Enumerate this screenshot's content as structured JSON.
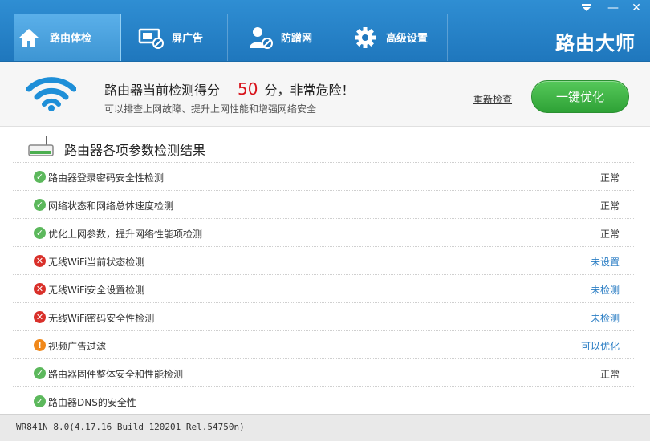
{
  "window": {
    "menu_icon": "dropdown-menu-icon",
    "min_label": "—",
    "close_label": "✕"
  },
  "tabs": [
    {
      "label": "路由体检",
      "icon": "home-icon",
      "active": true
    },
    {
      "label": "屏广告",
      "icon": "block-ad-icon",
      "active": false
    },
    {
      "label": "防蹭网",
      "icon": "user-block-icon",
      "active": false
    },
    {
      "label": "高级设置",
      "icon": "gear-icon",
      "active": false
    }
  ],
  "brand": "路由大师",
  "score_panel": {
    "title_prefix": "路由器当前检测得分",
    "score": "50",
    "title_suffix": "分，非常危险！",
    "subtitle": "可以排查上网故障、提升上网性能和增强网络安全",
    "recheck_label": "重新检查",
    "optimize_label": "一键优化"
  },
  "section": {
    "title": "路由器各项参数检测结果"
  },
  "checks": [
    {
      "label": "路由器登录密码安全性检测",
      "status": "ok",
      "result": "正常"
    },
    {
      "label": "网络状态和网络总体速度检测",
      "status": "ok",
      "result": "正常"
    },
    {
      "label": "优化上网参数，提升网络性能项检测",
      "status": "ok",
      "result": "正常"
    },
    {
      "label": "无线WiFi当前状态检测",
      "status": "error",
      "result": "未设置"
    },
    {
      "label": "无线WiFi安全设置检测",
      "status": "error",
      "result": "未检测"
    },
    {
      "label": "无线WiFi密码安全性检测",
      "status": "error",
      "result": "未检测"
    },
    {
      "label": "视频广告过滤",
      "status": "warning",
      "result": "可以优化"
    },
    {
      "label": "路由器固件整体安全和性能检测",
      "status": "ok",
      "result": "正常"
    },
    {
      "label": "路由器DNS的安全性",
      "status": "ok",
      "result": ""
    }
  ],
  "footer": {
    "firmware": "WR841N 8.0(4.17.16 Build 120201 Rel.54750n)"
  },
  "colors": {
    "accent": "#1f77bd",
    "danger": "#d8121a",
    "ok": "#5cb85c",
    "link": "#2a7dc4"
  }
}
